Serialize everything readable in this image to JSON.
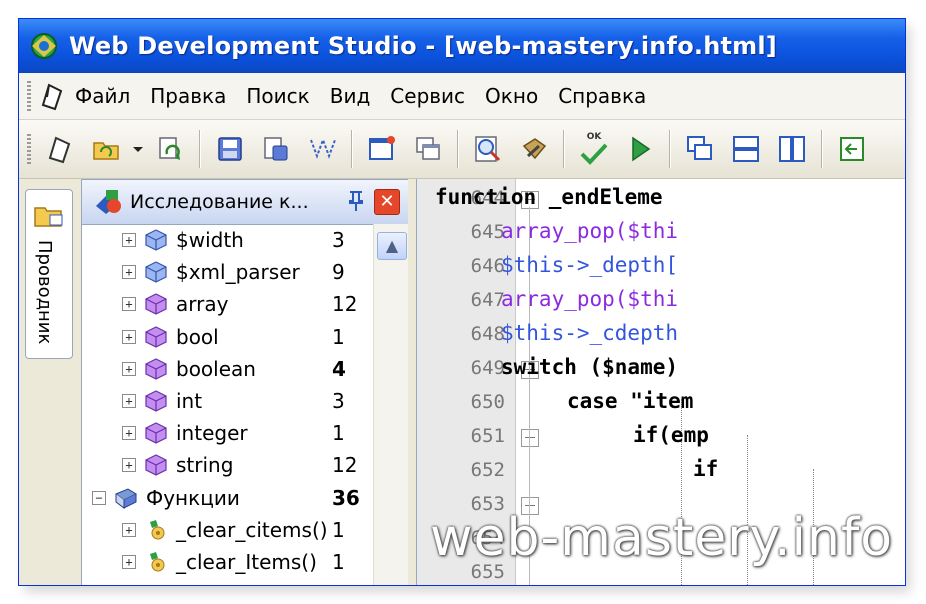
{
  "window": {
    "title": "Web Development Studio - [web-mastery.info.html]"
  },
  "menu": [
    "Файл",
    "Правка",
    "Поиск",
    "Вид",
    "Сервис",
    "Окно",
    "Справка"
  ],
  "toolbar": {
    "buttons": [
      "new-icon",
      "open-folder-icon",
      "dropdown-arrow-icon",
      "refresh-icon",
      "save-icon",
      "save-all-icon",
      "split-icon",
      "new-window-icon",
      "window-list-icon",
      "search-icon",
      "tools-icon",
      "check-icon",
      "run-icon",
      "cascade-icon",
      "tile-horizontal-icon",
      "tile-vertical-icon",
      "back-icon"
    ],
    "check_label": "OK"
  },
  "sidebar": {
    "tab_label": "Проводник"
  },
  "explorer": {
    "title": "Исследование к...",
    "rows": [
      {
        "label": "$width",
        "count": "3",
        "bold": false,
        "icon": "variable-cube-icon"
      },
      {
        "label": "$xml_parser",
        "count": "9",
        "bold": false,
        "icon": "variable-cube-icon"
      },
      {
        "label": "array",
        "count": "12",
        "bold": false,
        "icon": "type-cube-icon"
      },
      {
        "label": "bool",
        "count": "1",
        "bold": false,
        "icon": "type-cube-icon"
      },
      {
        "label": "boolean",
        "count": "4",
        "bold": true,
        "icon": "type-cube-icon"
      },
      {
        "label": "int",
        "count": "3",
        "bold": false,
        "icon": "type-cube-icon"
      },
      {
        "label": "integer",
        "count": "1",
        "bold": false,
        "icon": "type-cube-icon"
      },
      {
        "label": "string",
        "count": "12",
        "bold": false,
        "icon": "type-cube-icon"
      },
      {
        "label": "Функции",
        "count": "36",
        "bold": true,
        "icon": "book-icon"
      },
      {
        "label": "_clear_citems()",
        "count": "1",
        "bold": false,
        "icon": "function-gear-icon"
      },
      {
        "label": "_clear_Items()",
        "count": "1",
        "bold": false,
        "icon": "function-gear-icon"
      }
    ]
  },
  "editor": {
    "line_numbers": [
      "644",
      "645",
      "646",
      "647",
      "648",
      "649",
      "650",
      "651",
      "652",
      "653",
      "654",
      "655"
    ],
    "lines": [
      "function _endEleme",
      "array_pop($thi",
      "$this->_depth[",
      "array_pop($thi",
      "$this->_cdepth",
      "switch ($name)",
      "case \"item",
      "if(emp",
      "if",
      "",
      "",
      ""
    ]
  },
  "watermark": "web-mastery.info",
  "colors": {
    "titlebar": "#0a50da",
    "keyword_function": "#8a2be2",
    "variable": "#3355dd"
  }
}
